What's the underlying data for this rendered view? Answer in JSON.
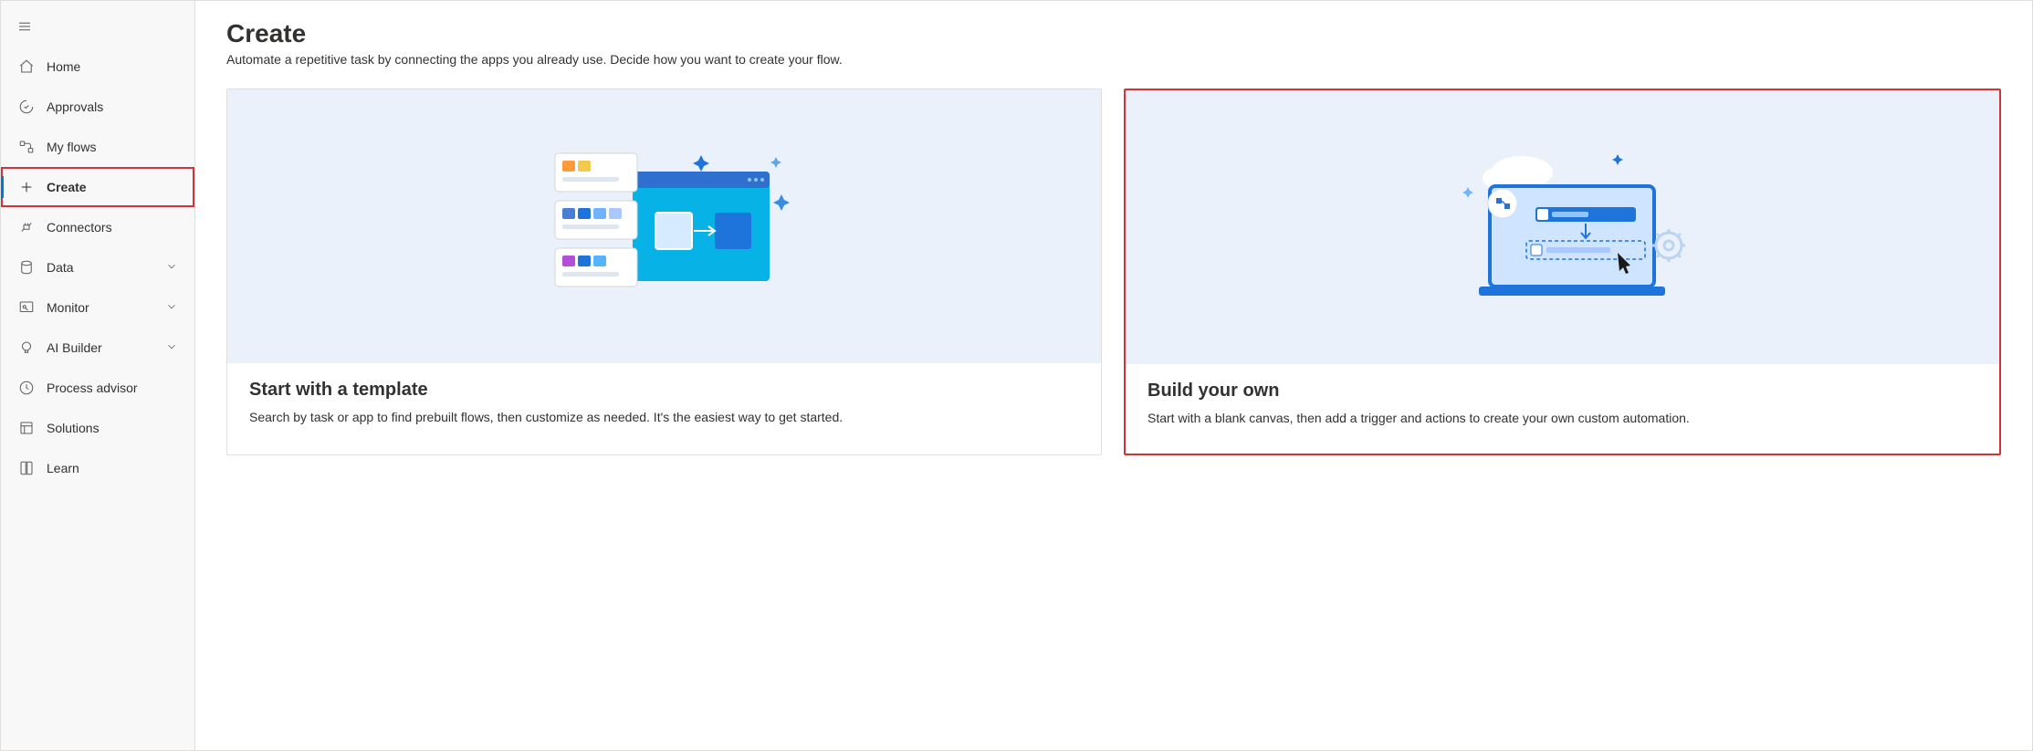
{
  "sidebar": {
    "items": [
      {
        "label": "Home"
      },
      {
        "label": "Approvals"
      },
      {
        "label": "My flows"
      },
      {
        "label": "Create"
      },
      {
        "label": "Connectors"
      },
      {
        "label": "Data"
      },
      {
        "label": "Monitor"
      },
      {
        "label": "AI Builder"
      },
      {
        "label": "Process advisor"
      },
      {
        "label": "Solutions"
      },
      {
        "label": "Learn"
      }
    ]
  },
  "page": {
    "title": "Create",
    "subtitle": "Automate a repetitive task by connecting the apps you already use. Decide how you want to create your flow."
  },
  "cards": {
    "template": {
      "title": "Start with a template",
      "desc": "Search by task or app to find prebuilt flows, then customize as needed. It's the easiest way to get started."
    },
    "build": {
      "title": "Build your own",
      "desc": "Start with a blank canvas, then add a trigger and actions to create your own custom automation."
    }
  }
}
